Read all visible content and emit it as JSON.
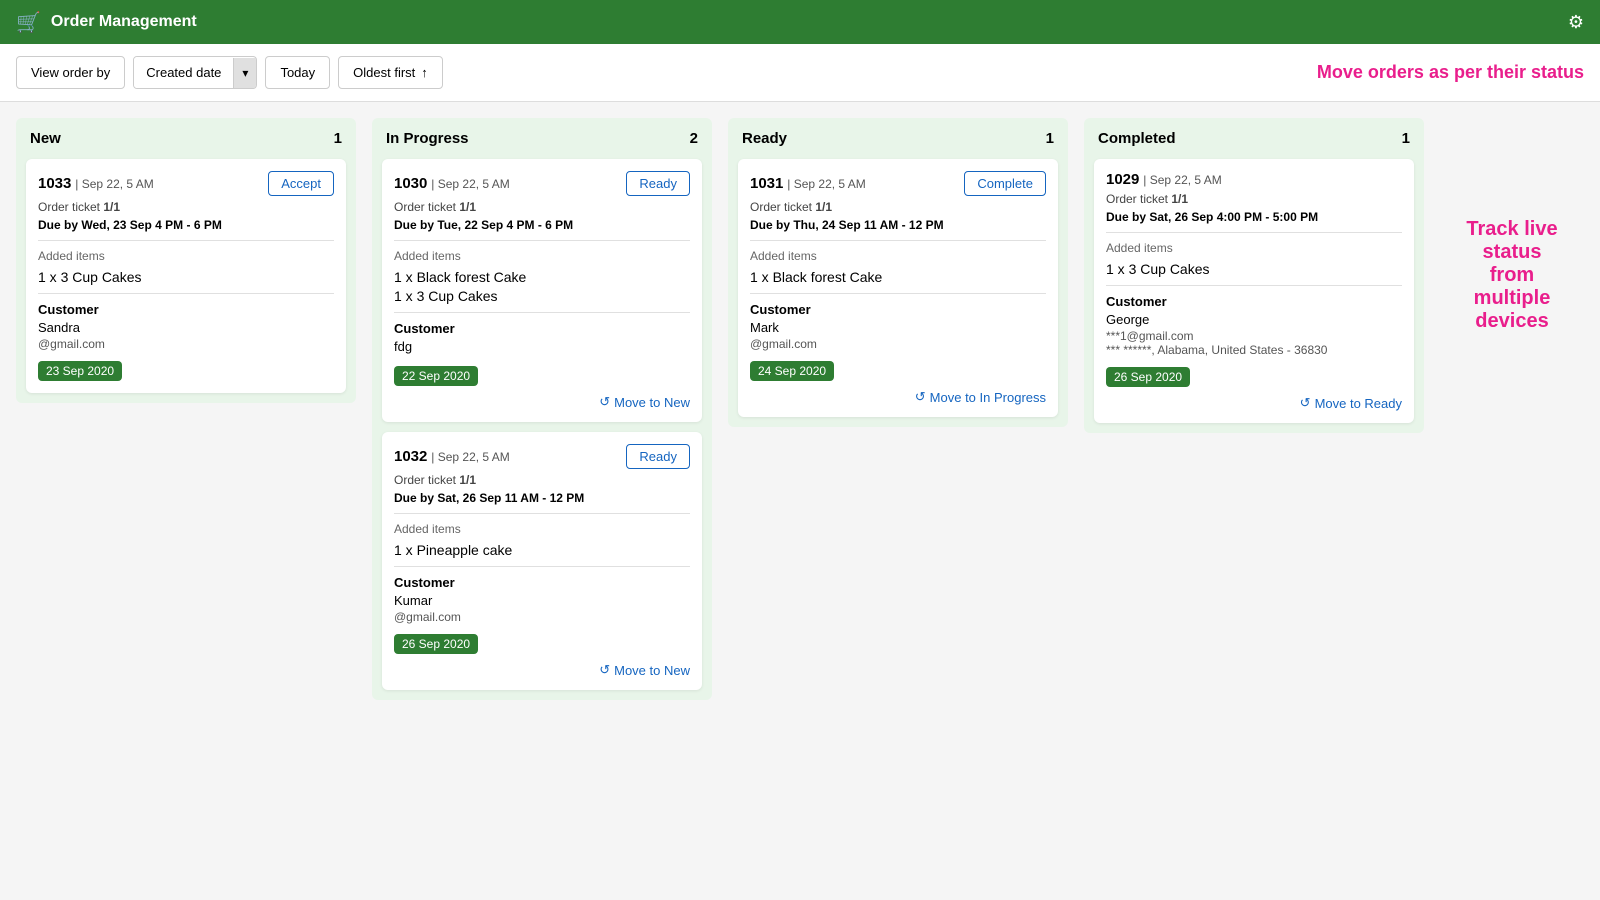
{
  "header": {
    "title": "Order Management",
    "icon": "🛒",
    "gear": "⚙"
  },
  "toolbar": {
    "view_label": "View order by",
    "sort_field": "Created date",
    "date_value": "Today",
    "sort_order": "Oldest first",
    "sort_icon": "↑",
    "promo": "Move orders as per their status"
  },
  "columns": [
    {
      "id": "new",
      "title": "New",
      "count": 1,
      "cards": [
        {
          "id": "1033",
          "date": "Sep 22, 5 AM",
          "ticket": "1/1",
          "due": "Due by Wed, 23 Sep 4 PM - 6 PM",
          "items": [
            "1 x 3 Cup Cakes"
          ],
          "customer_name": "Sandra",
          "customer_email": "@gmail.com",
          "badge": "23 Sep 2020",
          "action_label": "Accept",
          "action_type": "outline",
          "move_label": null
        }
      ]
    },
    {
      "id": "in-progress",
      "title": "In Progress",
      "count": 2,
      "cards": [
        {
          "id": "1030",
          "date": "Sep 22, 5 AM",
          "ticket": "1/1",
          "due": "Due by Tue, 22 Sep 4 PM - 6 PM",
          "items": [
            "1 x Black forest Cake",
            "1 x 3 Cup Cakes"
          ],
          "customer_name": "fdg",
          "customer_email": null,
          "badge": "22 Sep 2020",
          "action_label": "Ready",
          "action_type": "outline",
          "move_label": "Move to New"
        },
        {
          "id": "1032",
          "date": "Sep 22, 5 AM",
          "ticket": "1/1",
          "due": "Due by Sat, 26 Sep 11 AM - 12 PM",
          "items": [
            "1 x Pineapple cake"
          ],
          "customer_name": "Kumar",
          "customer_email": "@gmail.com",
          "badge": "26 Sep 2020",
          "action_label": "Ready",
          "action_type": "outline",
          "move_label": "Move to New"
        }
      ]
    },
    {
      "id": "ready",
      "title": "Ready",
      "count": 1,
      "cards": [
        {
          "id": "1031",
          "date": "Sep 22, 5 AM",
          "ticket": "1/1",
          "due": "Due by Thu, 24 Sep 11 AM - 12 PM",
          "items": [
            "1 x Black forest Cake"
          ],
          "customer_name": "Mark",
          "customer_email": "@gmail.com",
          "badge": "24 Sep 2020",
          "action_label": "Complete",
          "action_type": "outline",
          "move_label": "Move to In Progress"
        }
      ]
    },
    {
      "id": "completed",
      "title": "Completed",
      "count": 1,
      "cards": [
        {
          "id": "1029",
          "date": "Sep 22, 5 AM",
          "ticket": "1/1",
          "due": "Due by Sat, 26 Sep 4:00 PM - 5:00 PM",
          "items": [
            "1 x 3 Cup Cakes"
          ],
          "customer_name": "George",
          "customer_email": "***1@gmail.com",
          "address": "*** ******, Alabama, United States - 36830",
          "badge": "26 Sep 2020",
          "action_label": null,
          "action_type": null,
          "move_label": "Move to Ready"
        }
      ]
    }
  ],
  "promo_bottom": "Track live status from multiple devices",
  "labels": {
    "order_ticket": "Order ticket",
    "added_items": "Added items",
    "customer": "Customer"
  }
}
